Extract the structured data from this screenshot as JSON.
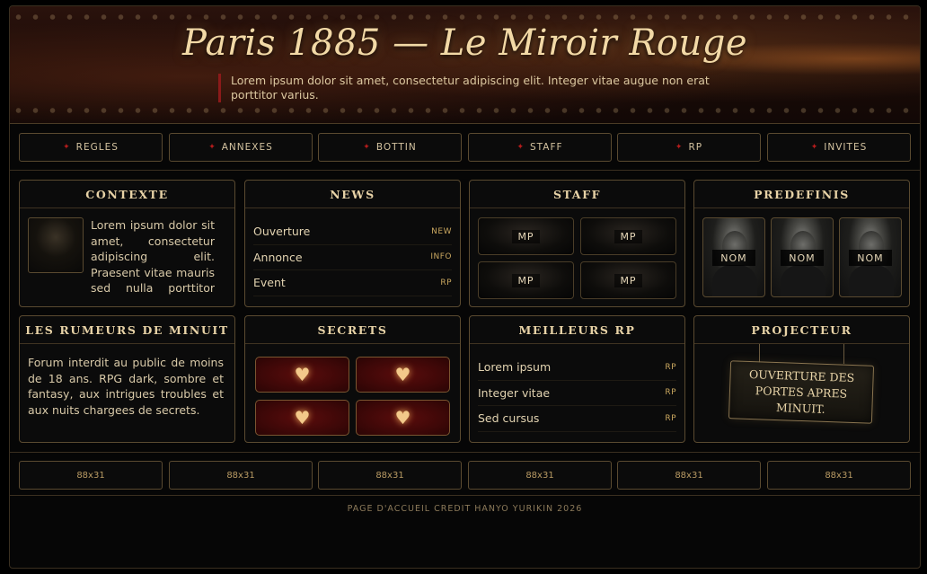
{
  "header": {
    "title": "Paris 1885 — Le Miroir Rouge",
    "description": "Lorem ipsum dolor sit amet, consectetur adipiscing elit. Integer vitae augue non erat porttitor varius."
  },
  "nav": [
    {
      "label": "REGLES",
      "icon": "star-icon"
    },
    {
      "label": "ANNEXES",
      "icon": "star-icon"
    },
    {
      "label": "BOTTIN",
      "icon": "star-icon"
    },
    {
      "label": "STAFF",
      "icon": "star-icon"
    },
    {
      "label": "RP",
      "icon": "star-icon"
    },
    {
      "label": "INVITES",
      "icon": "star-icon"
    }
  ],
  "contexte": {
    "title": "CONTEXTE",
    "text": "Lorem ipsum dolor sit amet, consectetur adipiscing elit. Praesent vitae mauris sed nulla porttitor facilisis."
  },
  "news": {
    "title": "NEWS",
    "items": [
      {
        "label": "Ouverture",
        "tag": "NEW"
      },
      {
        "label": "Annonce",
        "tag": "INFO"
      },
      {
        "label": "Event",
        "tag": "RP"
      }
    ]
  },
  "staff": {
    "title": "STAFF",
    "members": [
      "MP",
      "MP",
      "MP",
      "MP"
    ]
  },
  "predefinis": {
    "title": "PREDEFINIS",
    "items": [
      "NOM",
      "NOM",
      "NOM"
    ]
  },
  "rumeurs": {
    "title": "LES RUMEURS DE MINUIT",
    "text": "Forum interdit au public de moins de 18 ans. RPG dark, sombre et fantasy, aux intrigues troubles et aux nuits chargees de secrets."
  },
  "secrets": {
    "title": "SECRETS",
    "icons": [
      "♥",
      "♥",
      "♥",
      "♥"
    ]
  },
  "meilleurs": {
    "title": "MEILLEURS RP",
    "items": [
      {
        "label": "Lorem ipsum",
        "tag": "RP"
      },
      {
        "label": "Integer vitae",
        "tag": "RP"
      },
      {
        "label": "Sed cursus",
        "tag": "RP"
      }
    ]
  },
  "projecteur": {
    "title": "PROJECTEUR",
    "sign": "OUVERTURE DES PORTES APRES MINUIT."
  },
  "partners": [
    "88x31",
    "88x31",
    "88x31",
    "88x31",
    "88x31",
    "88x31"
  ],
  "footer": "PAGE D'ACCUEIL CREDIT HANYO YURIKIN 2026",
  "colors": {
    "accent_red": "#b51c1c",
    "gold": "#e7d2a6",
    "border": "#5a4a30",
    "background": "#060606"
  }
}
